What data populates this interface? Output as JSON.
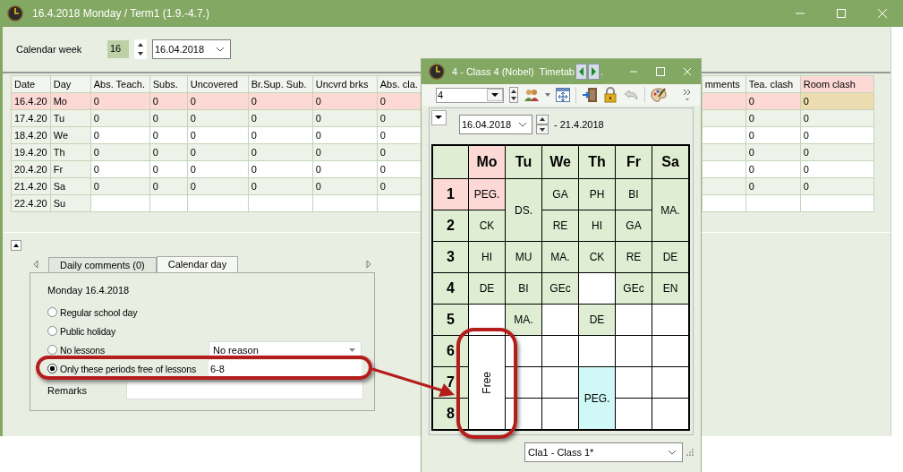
{
  "window": {
    "title": "16.4.2018 Monday / Term1 (1.9.-4.7.)"
  },
  "calendar_week": {
    "label": "Calendar week",
    "week": "16",
    "date": "16.04.2018"
  },
  "table": {
    "columns": [
      {
        "label": "Date",
        "selected": false
      },
      {
        "label": "Day",
        "selected": false
      },
      {
        "label": "Abs. Teach.",
        "selected": false
      },
      {
        "label": "Subs.",
        "selected": false
      },
      {
        "label": "Uncovered",
        "selected": false
      },
      {
        "label": "Br.Sup. Sub.",
        "selected": false
      },
      {
        "label": "Uncvrd brks",
        "selected": false
      },
      {
        "label": "Abs. cla.",
        "selected": false
      },
      {
        "label": "mments",
        "selected": false
      },
      {
        "label": "Tea. clash",
        "selected": false
      },
      {
        "label": "Room clash",
        "selected": true
      }
    ],
    "rows": [
      {
        "selected": true,
        "cells": [
          "16.4.20",
          "Mo",
          "0",
          "0",
          "0",
          "0",
          "0",
          "0",
          "",
          "0",
          "0"
        ]
      },
      {
        "selected": false,
        "cells": [
          "17.4.20",
          "Tu",
          "0",
          "0",
          "0",
          "0",
          "0",
          "0",
          "",
          "0",
          "0"
        ]
      },
      {
        "selected": false,
        "cells": [
          "18.4.20",
          "We",
          "0",
          "0",
          "0",
          "0",
          "0",
          "0",
          "",
          "0",
          "0"
        ]
      },
      {
        "selected": false,
        "cells": [
          "19.4.20",
          "Th",
          "0",
          "0",
          "0",
          "0",
          "0",
          "0",
          "",
          "0",
          "0"
        ]
      },
      {
        "selected": false,
        "cells": [
          "20.4.20",
          "Fr",
          "0",
          "0",
          "0",
          "0",
          "0",
          "0",
          "",
          "0",
          "0"
        ]
      },
      {
        "selected": false,
        "cells": [
          "21.4.20",
          "Sa",
          "0",
          "0",
          "0",
          "0",
          "0",
          "0",
          "",
          "0",
          "0"
        ]
      },
      {
        "selected": false,
        "cells": [
          "22.4.20",
          "Su"
        ]
      }
    ]
  },
  "tabs": [
    {
      "label": "Daily comments (0)",
      "selected": false
    },
    {
      "label": "Calendar day",
      "selected": true
    }
  ],
  "calendar_day": {
    "heading": "Monday 16.4.2018",
    "options": [
      {
        "label": "Regular school day",
        "selected": false
      },
      {
        "label": "Public holiday",
        "selected": false
      },
      {
        "label": "No lessons",
        "selected": false,
        "reason": "No reason"
      },
      {
        "label": "Only these periods free of lessons",
        "selected": true,
        "periods": "6-8"
      }
    ],
    "remarks_label": "Remarks"
  },
  "timetable": {
    "title": "4 - Class 4 (Nobel)  Timetab",
    "title_tail": ".",
    "class_field": "4",
    "from_date": "16.04.2018",
    "to_date": "- 21.4.2018",
    "periods": [
      {
        "label": "1",
        "selected": true
      },
      {
        "label": "2",
        "selected": false
      },
      {
        "label": "3",
        "selected": false
      },
      {
        "label": "4",
        "selected": false
      },
      {
        "label": "5",
        "selected": false
      },
      {
        "label": "6",
        "selected": false
      },
      {
        "label": "7",
        "selected": false
      },
      {
        "label": "8",
        "selected": false
      }
    ],
    "days": [
      {
        "label": "Mo",
        "selected": true,
        "slots": [
          {
            "text": "PEG.",
            "kind": "current"
          },
          {
            "text": "CK",
            "kind": "lesson"
          },
          {
            "text": "HI",
            "kind": "lesson"
          },
          {
            "text": "DE",
            "kind": "lesson"
          },
          {
            "kind": "empty"
          },
          {
            "text": "Free",
            "kind": "free"
          },
          {
            "merged": true
          },
          {
            "merged": true
          }
        ]
      },
      {
        "label": "Tu",
        "selected": false,
        "slots": [
          {
            "text": "DS.",
            "kind": "lesson"
          },
          {
            "merged": true
          },
          {
            "text": "MU",
            "kind": "lesson"
          },
          {
            "text": "BI",
            "kind": "lesson"
          },
          {
            "text": "MA.",
            "kind": "lesson"
          },
          {
            "kind": "empty"
          },
          {
            "kind": "empty"
          },
          {
            "kind": "empty"
          }
        ]
      },
      {
        "label": "We",
        "selected": false,
        "slots": [
          {
            "text": "GA",
            "kind": "lesson"
          },
          {
            "text": "RE",
            "kind": "lesson"
          },
          {
            "text": "MA.",
            "kind": "lesson"
          },
          {
            "text": "GEc",
            "kind": "lesson"
          },
          {
            "kind": "empty"
          },
          {
            "kind": "empty"
          },
          {
            "kind": "empty"
          },
          {
            "kind": "empty"
          }
        ]
      },
      {
        "label": "Th",
        "selected": false,
        "slots": [
          {
            "text": "PH",
            "kind": "lesson"
          },
          {
            "text": "HI",
            "kind": "lesson"
          },
          {
            "text": "CK",
            "kind": "lesson"
          },
          {
            "kind": "empty"
          },
          {
            "text": "DE",
            "kind": "lesson"
          },
          {
            "kind": "empty"
          },
          {
            "text": "PEG.",
            "kind": "substitution"
          },
          {
            "merged": true
          }
        ]
      },
      {
        "label": "Fr",
        "selected": false,
        "slots": [
          {
            "text": "BI",
            "kind": "lesson"
          },
          {
            "text": "GA",
            "kind": "lesson"
          },
          {
            "text": "RE",
            "kind": "lesson"
          },
          {
            "text": "GEc",
            "kind": "lesson"
          },
          {
            "kind": "empty"
          },
          {
            "kind": "empty"
          },
          {
            "kind": "empty"
          },
          {
            "kind": "empty"
          }
        ]
      },
      {
        "label": "Sa",
        "selected": false,
        "slots": [
          {
            "text": "MA.",
            "kind": "lesson"
          },
          {
            "merged": true
          },
          {
            "text": "DE",
            "kind": "lesson"
          },
          {
            "text": "EN",
            "kind": "lesson"
          },
          {
            "kind": "empty"
          },
          {
            "kind": "empty"
          },
          {
            "kind": "empty"
          },
          {
            "kind": "empty"
          }
        ]
      }
    ],
    "footer_class": "Cla1 - Class 1*"
  }
}
